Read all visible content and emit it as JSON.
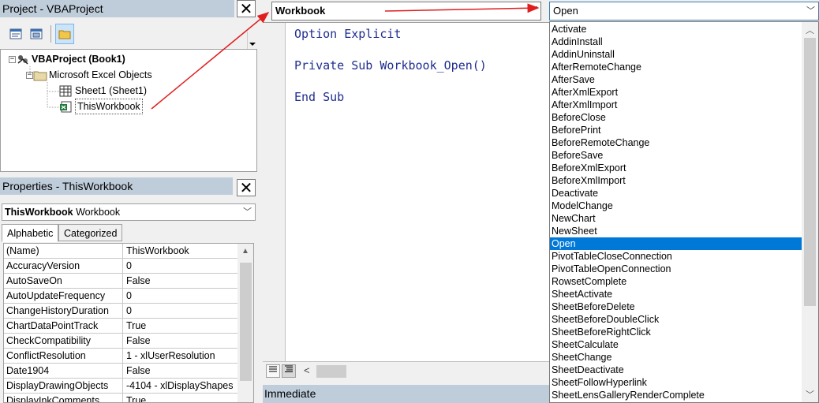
{
  "project_pane": {
    "title": "Project - VBAProject",
    "tree": {
      "root": "VBAProject (Book1)",
      "folder": "Microsoft Excel Objects",
      "sheet": "Sheet1 (Sheet1)",
      "workbook": "ThisWorkbook"
    }
  },
  "properties_pane": {
    "title": "Properties - ThisWorkbook",
    "object_name": "ThisWorkbook",
    "object_type": "Workbook",
    "tabs": [
      "Alphabetic",
      "Categorized"
    ],
    "rows": [
      {
        "name": "(Name)",
        "value": "ThisWorkbook"
      },
      {
        "name": "AccuracyVersion",
        "value": "0"
      },
      {
        "name": "AutoSaveOn",
        "value": "False"
      },
      {
        "name": "AutoUpdateFrequency",
        "value": "0"
      },
      {
        "name": "ChangeHistoryDuration",
        "value": "0"
      },
      {
        "name": "ChartDataPointTrack",
        "value": "True"
      },
      {
        "name": "CheckCompatibility",
        "value": "False"
      },
      {
        "name": "ConflictResolution",
        "value": "1 - xlUserResolution"
      },
      {
        "name": "Date1904",
        "value": "False"
      },
      {
        "name": "DisplayDrawingObjects",
        "value": "-4104 - xlDisplayShapes"
      },
      {
        "name": "DisplayInkComments",
        "value": "True"
      }
    ]
  },
  "code_window": {
    "object_combo": "Workbook",
    "procedure_combo": "Open",
    "lines": [
      "Option Explicit",
      "Private Sub Workbook_Open()",
      "End Sub"
    ],
    "immediate_title": "Immediate"
  },
  "procedure_list": {
    "selected": "Open",
    "items": [
      "Activate",
      "AddinInstall",
      "AddinUninstall",
      "AfterRemoteChange",
      "AfterSave",
      "AfterXmlExport",
      "AfterXmlImport",
      "BeforeClose",
      "BeforePrint",
      "BeforeRemoteChange",
      "BeforeSave",
      "BeforeXmlExport",
      "BeforeXmlImport",
      "Deactivate",
      "ModelChange",
      "NewChart",
      "NewSheet",
      "Open",
      "PivotTableCloseConnection",
      "PivotTableOpenConnection",
      "RowsetComplete",
      "SheetActivate",
      "SheetBeforeDelete",
      "SheetBeforeDoubleClick",
      "SheetBeforeRightClick",
      "SheetCalculate",
      "SheetChange",
      "SheetDeactivate",
      "SheetFollowHyperlink",
      "SheetLensGalleryRenderComplete"
    ]
  },
  "icons": {
    "close": "close-icon",
    "view_object": "view-object-icon",
    "view_code": "view-code-icon",
    "toggle_folders": "toggle-folders-icon",
    "project": "vba-project-icon",
    "folder": "folder-icon",
    "sheet": "sheet-icon",
    "workbook": "excel-workbook-icon"
  },
  "colors": {
    "title_bar": "#bfcddb",
    "code_text": "#1f2e8f",
    "selection": "#0078d7",
    "annotation_arrow": "#e01e1e"
  }
}
